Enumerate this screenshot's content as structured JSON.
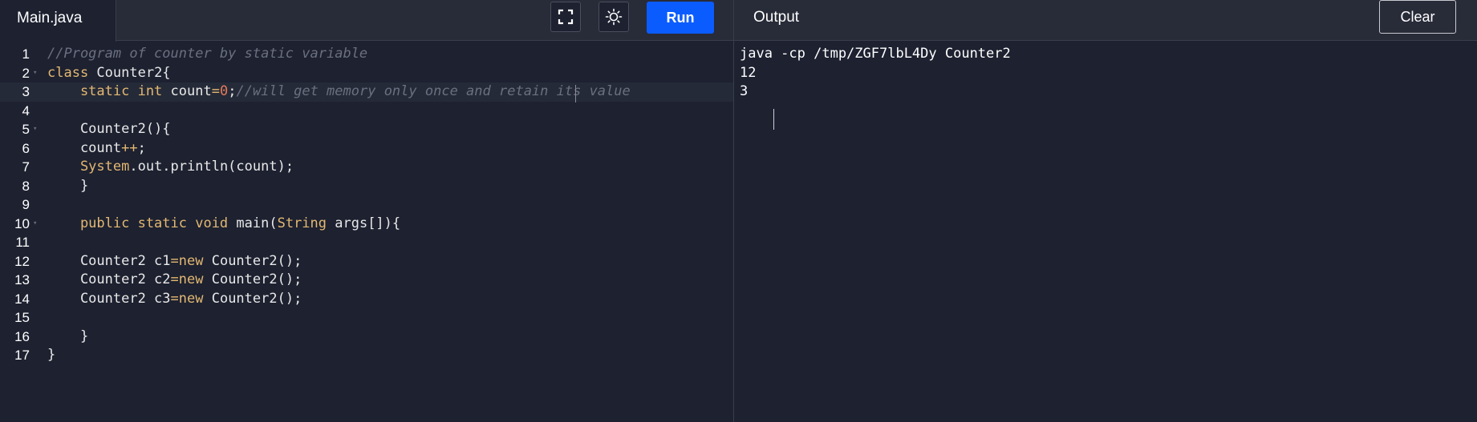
{
  "tab": {
    "filename": "Main.java"
  },
  "toolbar": {
    "fullscreen_icon": "fullscreen-icon",
    "theme_icon": "sun-icon",
    "run_label": "Run",
    "run_color": "#0b5cff"
  },
  "output_panel": {
    "title": "Output",
    "clear_label": "Clear",
    "lines": [
      "java -cp /tmp/ZGF7lbL4Dy Counter2",
      "12",
      "3"
    ]
  },
  "editor": {
    "line_numbers": [
      "1",
      "2",
      "3",
      "4",
      "5",
      "6",
      "7",
      "8",
      "9",
      "10",
      "11",
      "12",
      "13",
      "14",
      "15",
      "16",
      "17"
    ],
    "lines": [
      [
        {
          "t": "//Program of counter by static variable",
          "c": "comment"
        }
      ],
      [
        {
          "t": "class",
          "c": "kw"
        },
        {
          "t": " Counter2{",
          "c": "plain"
        }
      ],
      [
        {
          "t": "    static int",
          "c": "kw"
        },
        {
          "t": " count",
          "c": "plain"
        },
        {
          "t": "=",
          "c": "op"
        },
        {
          "t": "0",
          "c": "num"
        },
        {
          "t": ";",
          "c": "plain"
        },
        {
          "t": "//will get memory only once and retain its value",
          "c": "comment"
        }
      ],
      [],
      [
        {
          "t": "    Counter2(){",
          "c": "plain"
        }
      ],
      [
        {
          "t": "    count",
          "c": "plain"
        },
        {
          "t": "++",
          "c": "op"
        },
        {
          "t": ";",
          "c": "plain"
        }
      ],
      [
        {
          "t": "    System",
          "c": "type"
        },
        {
          "t": ".out.println(count);",
          "c": "plain"
        }
      ],
      [
        {
          "t": "    }",
          "c": "plain"
        }
      ],
      [],
      [
        {
          "t": "    public static void",
          "c": "kw"
        },
        {
          "t": " main(",
          "c": "plain"
        },
        {
          "t": "String",
          "c": "type"
        },
        {
          "t": " args[]){",
          "c": "plain"
        }
      ],
      [],
      [
        {
          "t": "    Counter2 c1",
          "c": "plain"
        },
        {
          "t": "=new",
          "c": "kw"
        },
        {
          "t": " Counter2();",
          "c": "plain"
        }
      ],
      [
        {
          "t": "    Counter2 c2",
          "c": "plain"
        },
        {
          "t": "=new",
          "c": "kw"
        },
        {
          "t": " Counter2();",
          "c": "plain"
        }
      ],
      [
        {
          "t": "    Counter2 c3",
          "c": "plain"
        },
        {
          "t": "=new",
          "c": "kw"
        },
        {
          "t": " Counter2();",
          "c": "plain"
        }
      ],
      [],
      [
        {
          "t": "    }",
          "c": "plain"
        }
      ],
      [
        {
          "t": "}",
          "c": "plain"
        }
      ]
    ],
    "fold_lines": [
      2,
      5,
      10
    ],
    "active_line": 3
  }
}
